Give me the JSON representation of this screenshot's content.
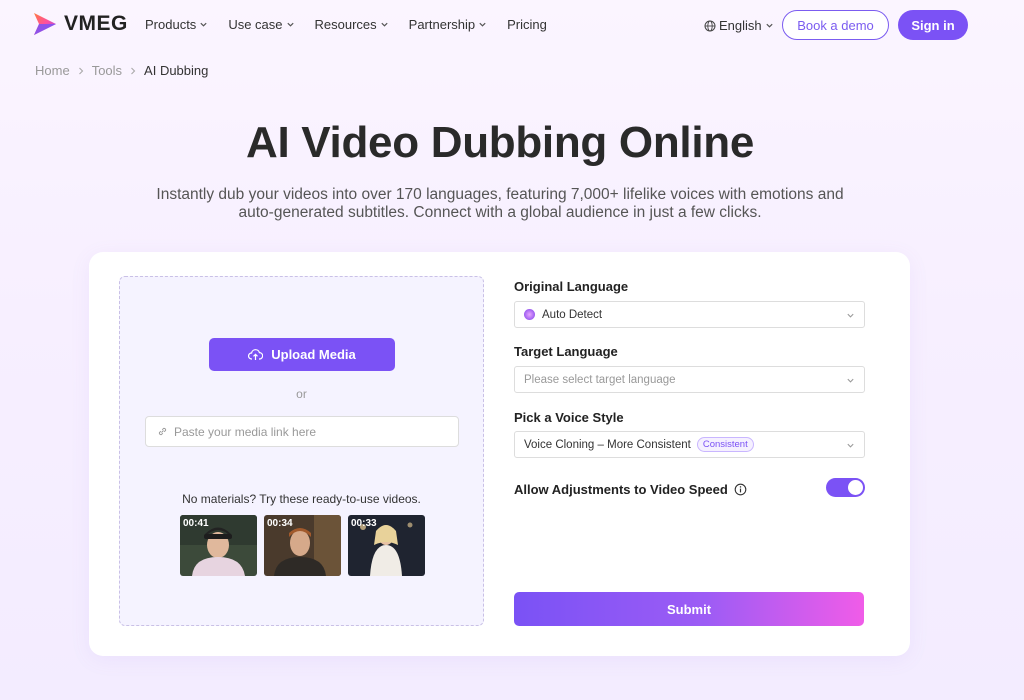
{
  "brand": {
    "name": "VMEG"
  },
  "nav": {
    "items": [
      {
        "label": "Products",
        "has_dropdown": true
      },
      {
        "label": "Use case",
        "has_dropdown": true
      },
      {
        "label": "Resources",
        "has_dropdown": true
      },
      {
        "label": "Partnership",
        "has_dropdown": true
      },
      {
        "label": "Pricing",
        "has_dropdown": false
      }
    ],
    "language": "English",
    "book_demo": "Book a demo",
    "sign_in": "Sign in"
  },
  "breadcrumb": {
    "items": [
      "Home",
      "Tools",
      "AI Dubbing"
    ]
  },
  "hero": {
    "title": "AI Video Dubbing Online",
    "subtitle_line1": "Instantly dub your videos into over 170 languages, featuring 7,000+ lifelike voices with emotions and",
    "subtitle_line2": "auto-generated subtitles. Connect with a global audience in just a few clicks."
  },
  "upload": {
    "button_label": "Upload Media",
    "or_text": "or",
    "link_placeholder": "Paste your media link here",
    "samples_title": "No materials? Try these ready-to-use videos.",
    "samples": [
      {
        "duration": "00:41"
      },
      {
        "duration": "00:34"
      },
      {
        "duration": "00:33"
      }
    ]
  },
  "form": {
    "original_language_label": "Original Language",
    "original_language_value": "Auto Detect",
    "target_language_label": "Target Language",
    "target_language_placeholder": "Please select target language",
    "voice_style_label": "Pick a Voice Style",
    "voice_style_value": "Voice Cloning – More Consistent",
    "voice_style_badge": "Consistent",
    "speed_label": "Allow Adjustments to Video Speed",
    "speed_enabled": true,
    "submit_label": "Submit"
  },
  "colors": {
    "accent": "#7b52f5",
    "gradient_end": "#f05ce8"
  }
}
